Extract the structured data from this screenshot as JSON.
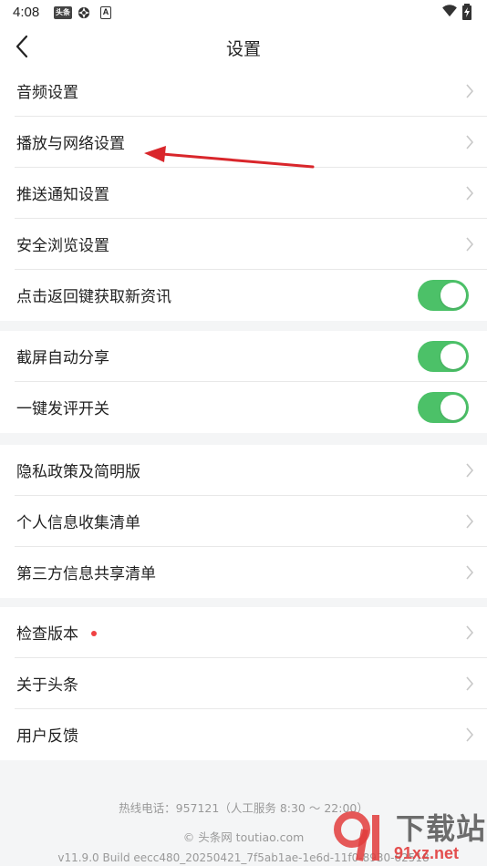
{
  "status_bar": {
    "time": "4:08",
    "app_badge": "头条",
    "font_badge": "A"
  },
  "header": {
    "title": "设置"
  },
  "groups": [
    {
      "items": [
        {
          "label": "音频设置",
          "control": "chevron"
        },
        {
          "label": "播放与网络设置",
          "control": "chevron"
        },
        {
          "label": "推送通知设置",
          "control": "chevron"
        },
        {
          "label": "安全浏览设置",
          "control": "chevron"
        },
        {
          "label": "点击返回键获取新资讯",
          "control": "toggle",
          "on": true
        }
      ]
    },
    {
      "items": [
        {
          "label": "截屏自动分享",
          "control": "toggle",
          "on": true
        },
        {
          "label": "一键发评开关",
          "control": "toggle",
          "on": true
        }
      ]
    },
    {
      "items": [
        {
          "label": "隐私政策及简明版",
          "control": "chevron"
        },
        {
          "label": "个人信息收集清单",
          "control": "chevron"
        },
        {
          "label": "第三方信息共享清单",
          "control": "chevron"
        }
      ]
    },
    {
      "items": [
        {
          "label": "检查版本",
          "control": "chevron",
          "dot": true
        },
        {
          "label": "关于头条",
          "control": "chevron"
        },
        {
          "label": "用户反馈",
          "control": "chevron"
        }
      ]
    }
  ],
  "footer": {
    "hotline": "热线电话：957121（人工服务 8:30 ～ 22:00）",
    "copyright": "© 头条网 toutiao.com",
    "build": "v11.9.0 Build eecc480_20250421_7f5ab1ae-1e6d-11f0-8930-62518"
  },
  "watermark": {
    "text": "下载站",
    "domain": "91xz.net"
  },
  "colors": {
    "toggle_on": "#4cc168",
    "annotation_arrow": "#d9262b",
    "dot": "#f04142"
  }
}
